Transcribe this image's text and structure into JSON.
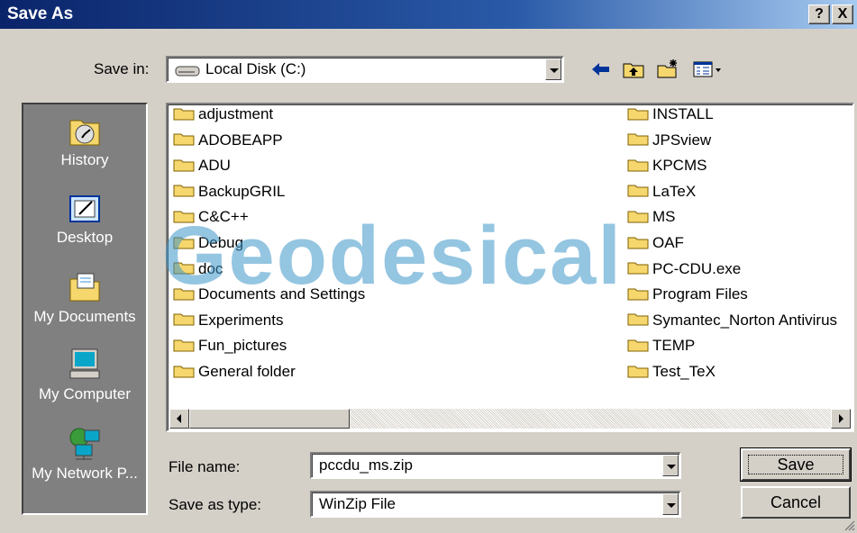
{
  "window": {
    "title": "Save As",
    "help_label": "?",
    "close_label": "X"
  },
  "save_in": {
    "label": "Save in:",
    "value": "Local Disk (C:)"
  },
  "toolbar": {
    "icons": [
      "back-arrow-icon",
      "up-folder-icon",
      "new-folder-icon",
      "view-menu-icon"
    ]
  },
  "places": [
    {
      "label": "History",
      "icon": "history-icon"
    },
    {
      "label": "Desktop",
      "icon": "desktop-icon"
    },
    {
      "label": "My Documents",
      "icon": "my-documents-icon"
    },
    {
      "label": "My Computer",
      "icon": "my-computer-icon"
    },
    {
      "label": "My Network P...",
      "icon": "network-places-icon"
    }
  ],
  "files": {
    "col1": [
      "adjustment",
      "ADOBEAPP",
      "ADU",
      "BackupGRIL",
      "C&C++",
      "Debug",
      "doc",
      "Documents and Settings",
      "Experiments",
      "Fun_pictures",
      "General folder"
    ],
    "col2": [
      "INSTALL",
      "JPSview",
      "KPCMS",
      "LaTeX",
      "MS",
      "OAF",
      "PC-CDU.exe",
      "Program Files",
      "Symantec_Norton Antivirus",
      "TEMP",
      "Test_TeX"
    ]
  },
  "file_name": {
    "label": "File name:",
    "value": "pccdu_ms.zip"
  },
  "save_type": {
    "label": "Save as type:",
    "value": "WinZip File"
  },
  "buttons": {
    "save": "Save",
    "cancel": "Cancel"
  },
  "watermark": "Geodesical",
  "colors": {
    "title_bar": "#0a246a",
    "face": "#d4d0c8",
    "places_bg": "#808080",
    "folder": "#f5d76e"
  }
}
